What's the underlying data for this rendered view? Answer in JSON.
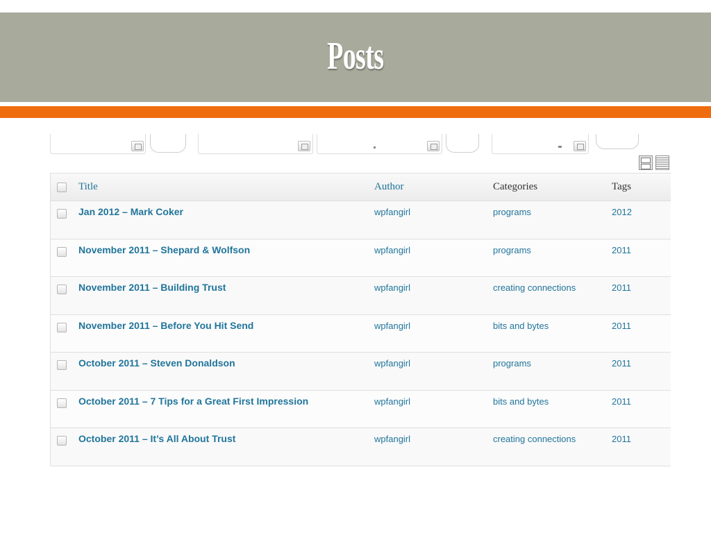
{
  "slide": {
    "title": "Posts",
    "colors": {
      "band": "#a8ab9c",
      "accent_bar": "#ef6c0e",
      "link": "#21759b"
    }
  },
  "table": {
    "headers": {
      "title": "Title",
      "author": "Author",
      "categories": "Categories",
      "tags": "Tags"
    },
    "rows": [
      {
        "title": "Jan 2012 – Mark Coker",
        "author": "wpfangirl",
        "category": "programs",
        "tags": "2012"
      },
      {
        "title": "November 2011 – Shepard & Wolfson",
        "author": "wpfangirl",
        "category": "programs",
        "tags": "2011"
      },
      {
        "title": "November 2011 – Building Trust",
        "author": "wpfangirl",
        "category": "creating connections",
        "tags": "2011"
      },
      {
        "title": "November 2011 – Before You Hit Send",
        "author": "wpfangirl",
        "category": "bits and bytes",
        "tags": "2011"
      },
      {
        "title": "October 2011 – Steven Donaldson",
        "author": "wpfangirl",
        "category": "programs",
        "tags": "2011"
      },
      {
        "title": "October 2011 – 7 Tips for a Great First Impression",
        "author": "wpfangirl",
        "category": "bits and bytes",
        "tags": "2011"
      },
      {
        "title": "October 2011 – It’s All About Trust",
        "author": "wpfangirl",
        "category": "creating connections",
        "tags": "2011"
      }
    ]
  },
  "icons": {
    "list_view": "list-view-icon",
    "excerpt_view": "excerpt-view-icon"
  }
}
